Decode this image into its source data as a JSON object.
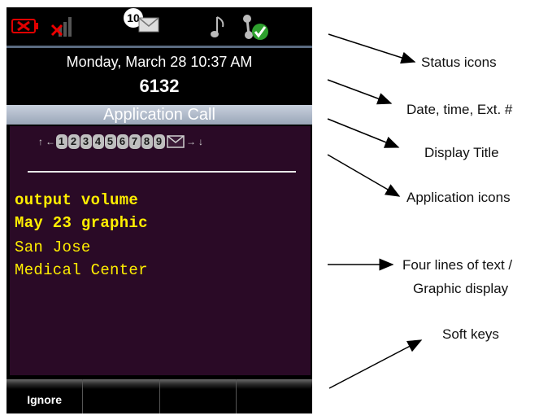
{
  "status": {
    "battery_icon": "battery-alert-icon",
    "signal_icon": "no-signal-icon",
    "message_count": "10",
    "message_icon": "message-envelope-icon",
    "ringer_icon": "music-note-icon",
    "network_icon": "network-ok-icon"
  },
  "header": {
    "date": "Monday, March 28 10:37 AM",
    "extension": "6132"
  },
  "title": "Application Call",
  "app_icons": {
    "left_arrows": [
      "↑",
      "←"
    ],
    "numbers": [
      "1",
      "2",
      "3",
      "4",
      "5",
      "6",
      "7",
      "8",
      "9"
    ],
    "right_arrows": [
      "→",
      "↓"
    ]
  },
  "text_lines": [
    "output volume",
    "May 23 graphic",
    "San Jose",
    "Medical Center"
  ],
  "softkeys": [
    "Ignore",
    "",
    "",
    ""
  ],
  "annotations": {
    "status_icons": "Status icons",
    "date_time_ext": "Date, time, Ext. #",
    "display_title": "Display Title",
    "application_icons": "Application icons",
    "four_lines_1": "Four lines of text /",
    "four_lines_2": "Graphic display",
    "soft_keys": "Soft keys"
  },
  "colors": {
    "screen_bg": "#2a0a26",
    "text_yellow": "#ffee00",
    "title_bar": "#a8b2c4"
  }
}
